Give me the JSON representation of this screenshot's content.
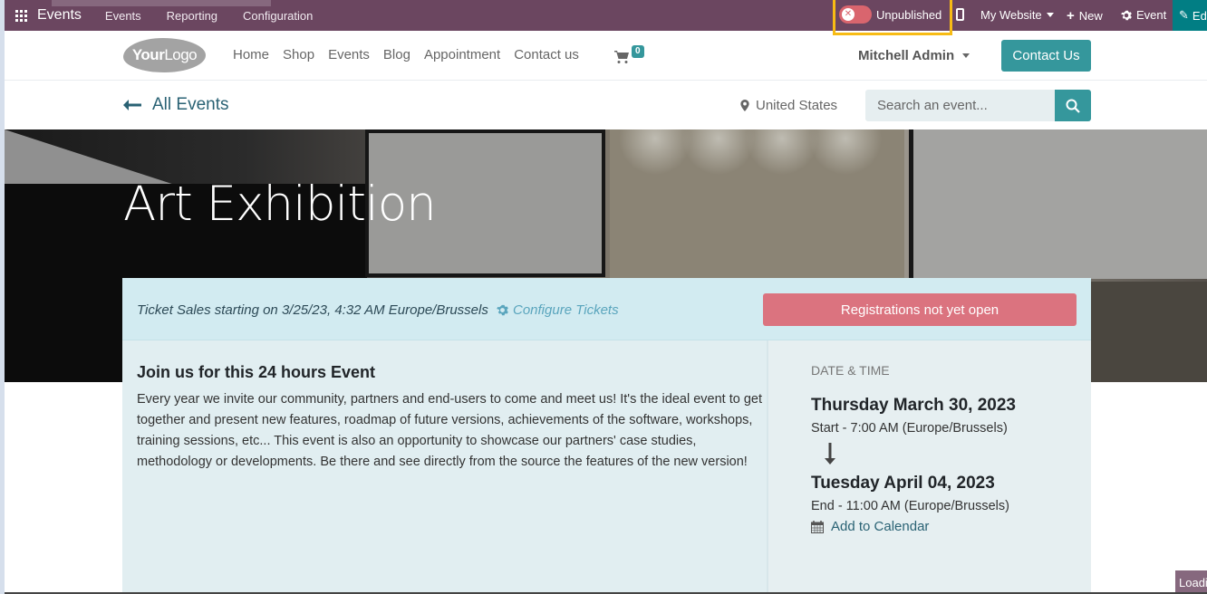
{
  "admin_bar": {
    "app_name": "Events",
    "menu": [
      "Events",
      "Reporting",
      "Configuration"
    ],
    "publish_state": "Unpublished",
    "website_selector": "My Website",
    "new_label": "New",
    "event_label": "Event",
    "edit_label": "Edit",
    "colors": {
      "bar": "#6b4660",
      "edit": "#017e84",
      "highlight": "#f7bb14",
      "toggle": "#d9656e"
    }
  },
  "header": {
    "logo": {
      "bold": "Your",
      "light": "Logo"
    },
    "nav": [
      "Home",
      "Shop",
      "Events",
      "Blog",
      "Appointment",
      "Contact us"
    ],
    "cart_count": "0",
    "user_name": "Mitchell Admin",
    "contact_button": "Contact Us",
    "accent": "#35979c"
  },
  "sub_header": {
    "back_label": "All Events",
    "location": "United States",
    "search_placeholder": "Search an event..."
  },
  "hero": {
    "title": "Art Exhibition"
  },
  "event": {
    "ticket_sales": "Ticket Sales starting on 3/25/23, 4:32 AM Europe/Brussels",
    "configure_tickets": "Configure Tickets",
    "registration_status": "Registrations not yet open",
    "description_title": "Join us for this 24 hours Event",
    "description": "Every year we invite our community, partners and end-users to come and meet us! It's the ideal event to get together and present new features, roadmap of future versions, achievements of the software, workshops, training sessions, etc... This event is also an opportunity to showcase our partners' case studies, methodology or developments. Be there and see directly from the source the features of the new version!",
    "date_time_label": "Date & Time",
    "start_date": "Thursday March 30, 2023",
    "start_time": "Start - 7:00 AM (Europe/Brussels)",
    "end_date": "Tuesday April 04, 2023",
    "end_time": "End - 11:00 AM (Europe/Brussels)",
    "add_to_calendar": "Add to Calendar"
  },
  "loading_text": "Loading"
}
